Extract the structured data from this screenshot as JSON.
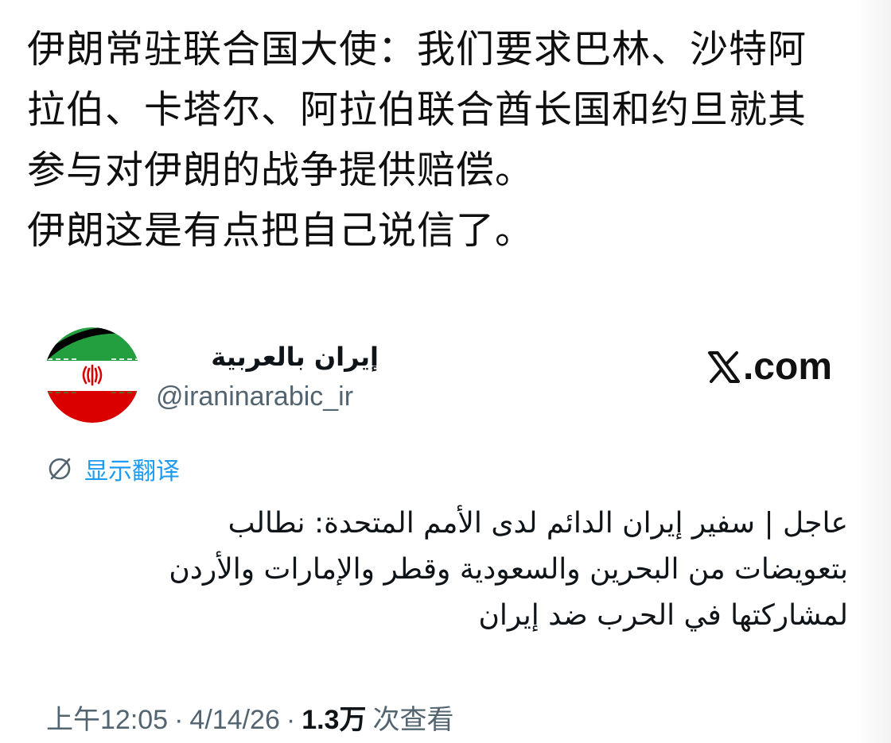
{
  "post": {
    "lines": [
      "伊朗常驻联合国大使：我们要求巴林、沙特阿",
      "拉伯、卡塔尔、阿拉伯联合酋长国和约旦就其",
      "参与对伊朗的战争提供赔偿。",
      "伊朗这是有点把自己说信了。"
    ]
  },
  "tweet": {
    "display_name": "إيران بالعربية",
    "handle": "@iraninarabic_ir",
    "brand": ".com",
    "brand_icon": "x-logo-icon",
    "translate_label": "显示翻译",
    "translate_icon": "globe-icon",
    "arabic_lines": [
      "عاجل | سفير إيران الدائم لدى الأمم المتحدة: نطالب",
      "بتعويضات من البحرين والسعودية وقطر والإمارات والأردن",
      "لمشاركتها في الحرب ضد إيران"
    ],
    "meta": {
      "time": "上午12:05",
      "sep1": "·",
      "date": "4/14/26",
      "sep2": "·",
      "views": "1.3万",
      "views_label": "次查看"
    }
  },
  "colors": {
    "link_blue": "#1d9bf0",
    "muted_gray": "#536471",
    "flag_green": "#239f40",
    "flag_red": "#da0000",
    "flag_white": "#ffffff",
    "mourning_band": "#000000"
  }
}
